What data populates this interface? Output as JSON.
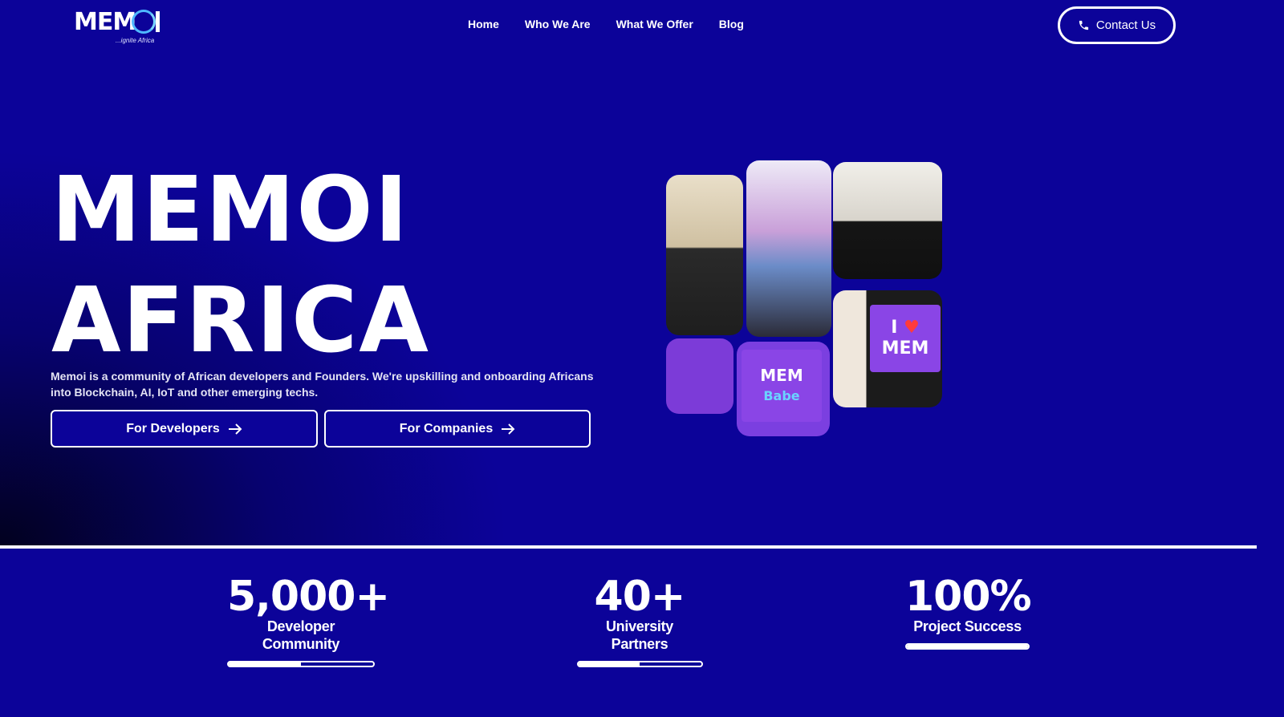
{
  "brand": {
    "name": "MEM",
    "tagline": "...ignite Africa"
  },
  "nav": {
    "items": [
      "Home",
      "Who We Are",
      "What We Offer",
      "Blog"
    ],
    "contact_label": "Contact Us"
  },
  "hero": {
    "title_line1": "MEMOI",
    "title_line2": "AFRICA",
    "description": "Memoi is a community of African developers and Founders. We're upskilling and onboarding Africans into Blockchain, AI, IoT and other emerging techs.",
    "btn_developers": "For Developers",
    "btn_companies": "For Companies"
  },
  "collage": {
    "sign1_line1": "I",
    "sign1_line2": "MEM",
    "sign2_line1": "MEM",
    "sign2_line2": "Babe"
  },
  "stats": [
    {
      "value": "5,000+",
      "label": "Developer Community",
      "progress": 0.5
    },
    {
      "value": "40+",
      "label": "University Partners",
      "progress": 0.5
    },
    {
      "value": "100%",
      "label": "Project Success",
      "progress": 1.0
    }
  ],
  "colors": {
    "background": "#0c0399",
    "text": "#ffffff",
    "accent": "#4fb8ff"
  },
  "icons": {
    "contact": "phone-icon",
    "button_arrow": "arrow-right-icon"
  }
}
